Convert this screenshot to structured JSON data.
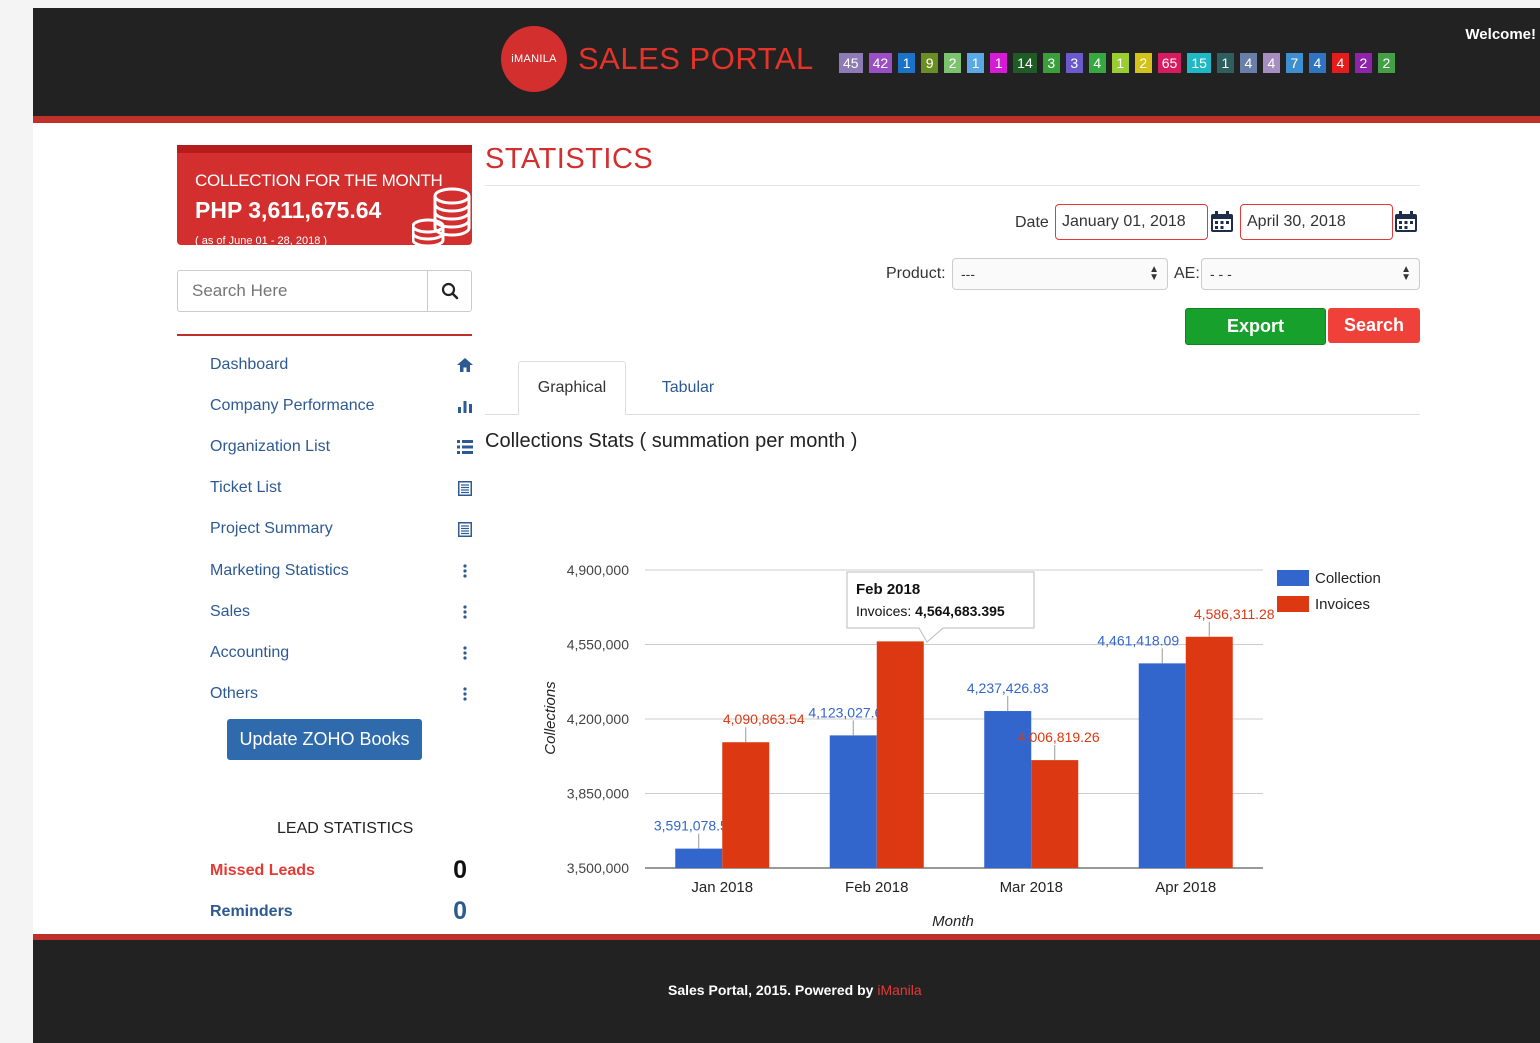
{
  "header": {
    "logo_text": "iMANILA",
    "brand": "SALES PORTAL",
    "welcome": "Welcome!",
    "badges": [
      {
        "value": "45",
        "color": "#8e7ab5"
      },
      {
        "value": "42",
        "color": "#9b4fc4"
      },
      {
        "value": "1",
        "color": "#1a73c8"
      },
      {
        "value": "9",
        "color": "#6b8e23"
      },
      {
        "value": "2",
        "color": "#7cc36f"
      },
      {
        "value": "1",
        "color": "#5aa9e6"
      },
      {
        "value": "1",
        "color": "#d61ad6"
      },
      {
        "value": "14",
        "color": "#1e5b25"
      },
      {
        "value": "3",
        "color": "#3a9e3a"
      },
      {
        "value": "3",
        "color": "#6a5acd"
      },
      {
        "value": "4",
        "color": "#36a840"
      },
      {
        "value": "1",
        "color": "#9acd32"
      },
      {
        "value": "2",
        "color": "#d4c21a"
      },
      {
        "value": "65",
        "color": "#d81b60"
      },
      {
        "value": "15",
        "color": "#1fb8c4"
      },
      {
        "value": "1",
        "color": "#2e5e5e"
      },
      {
        "value": "4",
        "color": "#6a7fa8"
      },
      {
        "value": "4",
        "color": "#a68fc0"
      },
      {
        "value": "7",
        "color": "#3d8fcf"
      },
      {
        "value": "4",
        "color": "#2f74c0"
      },
      {
        "value": "4",
        "color": "#e51c1c"
      },
      {
        "value": "2",
        "color": "#8e24aa"
      },
      {
        "value": "2",
        "color": "#43a047"
      }
    ]
  },
  "collection": {
    "title": "COLLECTION FOR THE MONTH",
    "amount": "PHP 3,611,675.64",
    "as_of": "( as of June 01 - 28, 2018 )"
  },
  "sidebar": {
    "search_placeholder": "Search Here",
    "items": [
      {
        "label": "Dashboard",
        "icon": "home-icon"
      },
      {
        "label": "Company Performance",
        "icon": "bar-chart-icon"
      },
      {
        "label": "Organization List",
        "icon": "list-icon"
      },
      {
        "label": "Ticket List",
        "icon": "document-icon"
      },
      {
        "label": "Project Summary",
        "icon": "document-icon"
      },
      {
        "label": "Marketing Statistics",
        "icon": "more-vertical-icon"
      },
      {
        "label": "Sales",
        "icon": "more-vertical-icon"
      },
      {
        "label": "Accounting",
        "icon": "more-vertical-icon"
      },
      {
        "label": "Others",
        "icon": "more-vertical-icon"
      }
    ],
    "zoho_button": "Update ZOHO Books",
    "lead_stats_title": "LEAD STATISTICS",
    "missed_leads_label": "Missed Leads",
    "missed_leads_count": "0",
    "reminders_label": "Reminders",
    "reminders_count": "0"
  },
  "main": {
    "title": "STATISTICS",
    "date_label": "Date",
    "date_from": "January 01, 2018",
    "date_to": "April 30, 2018",
    "product_label": "Product:",
    "product_value": "---",
    "ae_label": "AE:",
    "ae_value": "- - -",
    "export_label": "Export",
    "search_label": "Search",
    "tabs": [
      "Graphical",
      "Tabular"
    ],
    "chart_title": "Collections Stats ( summation per month )"
  },
  "tooltip": {
    "title": "Feb 2018",
    "label": "Invoices: ",
    "value": "4,564,683.395"
  },
  "chart_data": {
    "type": "bar",
    "categories": [
      "Jan 2018",
      "Feb 2018",
      "Mar 2018",
      "Apr 2018"
    ],
    "series": [
      {
        "name": "Collection",
        "color": "#3366cc",
        "values": [
          3591078.51,
          4123027.6,
          4237426.83,
          4461418.09
        ],
        "labels": [
          "3,591,078.51",
          "4,123,027.60",
          "4,237,426.83",
          "4,461,418.09"
        ]
      },
      {
        "name": "Invoices",
        "color": "#dc3912",
        "values": [
          4090863.54,
          4564683.395,
          4006819.26,
          4586311.28
        ],
        "labels": [
          "4,090,863.54",
          "",
          "4,006,819.26",
          "4,586,311.28"
        ]
      }
    ],
    "y_ticks": [
      "4,900,000",
      "4,550,000",
      "4,200,000",
      "3,850,000",
      "3,500,000"
    ],
    "y_tick_values": [
      4900000,
      4550000,
      4200000,
      3850000,
      3500000
    ],
    "ylim": [
      3500000,
      4900000
    ],
    "xlabel": "Month",
    "ylabel": "Collections",
    "legend_position": "right",
    "grid": true
  },
  "footer": {
    "text": "Sales Portal, 2015. Powered by ",
    "brand": "iManila"
  }
}
